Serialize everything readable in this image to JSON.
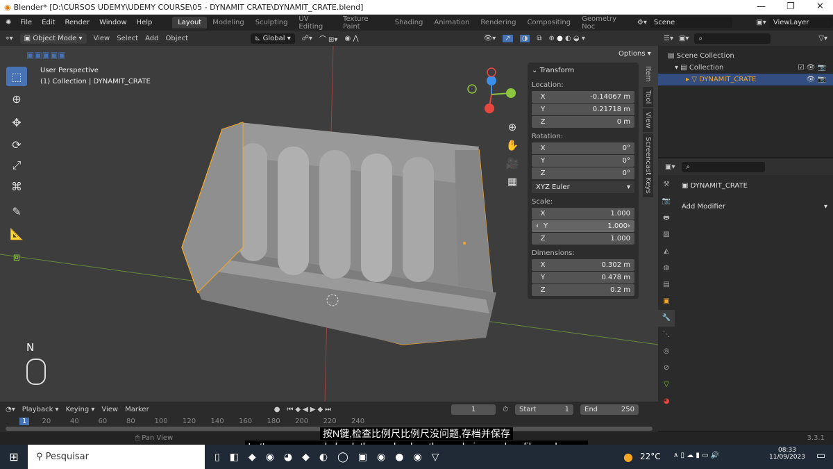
{
  "window": {
    "title": "Blender* [D:\\CURSOS UDEMY\\UDEMY COURSE\\05 - DYNAMIT CRATE\\DYNAMIT_CRATE.blend]"
  },
  "menu": [
    "File",
    "Edit",
    "Render",
    "Window",
    "Help"
  ],
  "workspaces": [
    "Layout",
    "Modeling",
    "Sculpting",
    "UV Editing",
    "Texture Paint",
    "Shading",
    "Animation",
    "Rendering",
    "Compositing",
    "Geometry Noc"
  ],
  "scene": "Scene",
  "view_layer": "ViewLayer",
  "viewport_header": {
    "mode": "Object Mode",
    "menus": [
      "View",
      "Select",
      "Add",
      "Object"
    ],
    "orientation": "Global",
    "options": "Options"
  },
  "viewport": {
    "perspective": "User Perspective",
    "collection_info": "(1) Collection | DYNAMIT_CRATE",
    "key_hint": "N"
  },
  "npanel": {
    "section": "Transform",
    "location_label": "Location:",
    "location": [
      {
        "axis": "X",
        "value": "-0.14067 m"
      },
      {
        "axis": "Y",
        "value": "0.21718 m"
      },
      {
        "axis": "Z",
        "value": "0 m"
      }
    ],
    "rotation_label": "Rotation:",
    "rotation": [
      {
        "axis": "X",
        "value": "0°"
      },
      {
        "axis": "Y",
        "value": "0°"
      },
      {
        "axis": "Z",
        "value": "0°"
      }
    ],
    "rotation_mode": "XYZ Euler",
    "scale_label": "Scale:",
    "scale": [
      {
        "axis": "X",
        "value": "1.000"
      },
      {
        "axis": "Y",
        "value": "1.000"
      },
      {
        "axis": "Z",
        "value": "1.000"
      }
    ],
    "dimensions_label": "Dimensions:",
    "dimensions": [
      {
        "axis": "X",
        "value": "0.302 m"
      },
      {
        "axis": "Y",
        "value": "0.478 m"
      },
      {
        "axis": "Z",
        "value": "0.2 m"
      }
    ],
    "tabs": [
      "Item",
      "Tool",
      "View",
      "Screencast Keys"
    ]
  },
  "outliner": {
    "items": [
      "Scene Collection",
      "Collection",
      "DYNAMIT_CRATE"
    ]
  },
  "properties": {
    "object": "DYNAMIT_CRATE",
    "add_modifier": "Add Modifier"
  },
  "timeline": {
    "menus": [
      "Playback",
      "Keying",
      "View",
      "Marker"
    ],
    "current_frame": "1",
    "start_label": "Start",
    "start": "1",
    "end_label": "End",
    "end": "250",
    "ticks": [
      "1",
      "20",
      "40",
      "60",
      "80",
      "100",
      "120",
      "140",
      "160",
      "180",
      "200",
      "220",
      "240"
    ]
  },
  "statusbar": {
    "hint": "Pan View",
    "version": "3.3.1"
  },
  "subtitles": {
    "zh": "按N键,检查比例尺比例尺没问题,存档并保存",
    "en": "Let's press n and check the scale,okay,the scale is good,so file and save,"
  },
  "taskbar": {
    "search_placeholder": "Pesquisar",
    "temperature": "22°C",
    "time": "08:33",
    "date": "11/09/2023"
  },
  "colors": {
    "selection": "#f5a623",
    "active_tab": "#4772b3",
    "x_axis": "#e8473f",
    "y_axis": "#8cc63f",
    "z_axis": "#3b8fe8"
  }
}
